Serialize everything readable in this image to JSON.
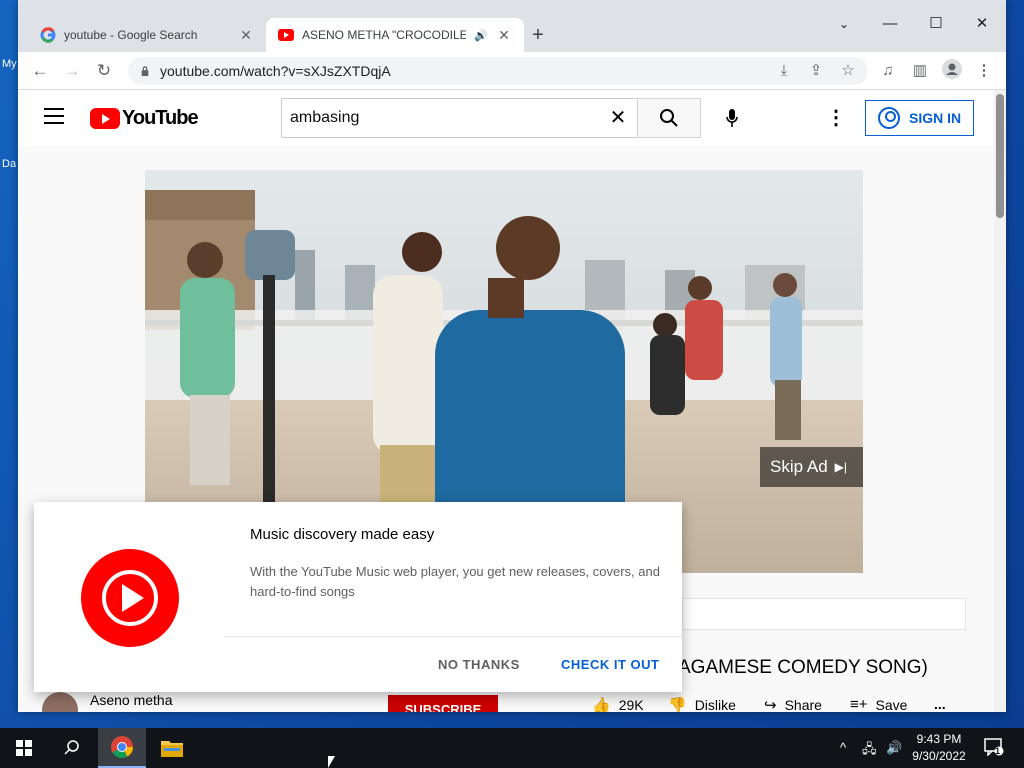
{
  "desktop": {
    "label_my": "My",
    "label_d": "Da"
  },
  "browser": {
    "tabs": [
      {
        "title": "youtube - Google Search",
        "close": "✕"
      },
      {
        "title": "ASENO METHA \"CROCODILE",
        "close": "✕"
      }
    ],
    "new_tab": "+",
    "url": "youtube.com/watch?v=sXJsZXTDqjA"
  },
  "youtube": {
    "logo_text": "YouTube",
    "search_value": "ambasing",
    "sign_in": "SIGN IN",
    "skip_ad": "Skip Ad",
    "video_title": "AGAMESE COMEDY SONG)",
    "channel_name": "Aseno metha",
    "subscribe": "SUBSCRIBE",
    "likes": "29K",
    "dislike": "Dislike",
    "share": "Share",
    "save": "Save",
    "more": "..."
  },
  "popup": {
    "title": "Music discovery made easy",
    "body": "With the YouTube Music web player, you get new releases, covers, and hard-to-find songs",
    "no_thanks": "NO THANKS",
    "check_it_out": "CHECK IT OUT"
  },
  "taskbar": {
    "time": "9:43 PM",
    "date": "9/30/2022",
    "notifications": "1"
  },
  "colors": {
    "youtube_red": "#ff0000",
    "link_blue": "#065fd4",
    "subscribe_red": "#cc0000"
  }
}
